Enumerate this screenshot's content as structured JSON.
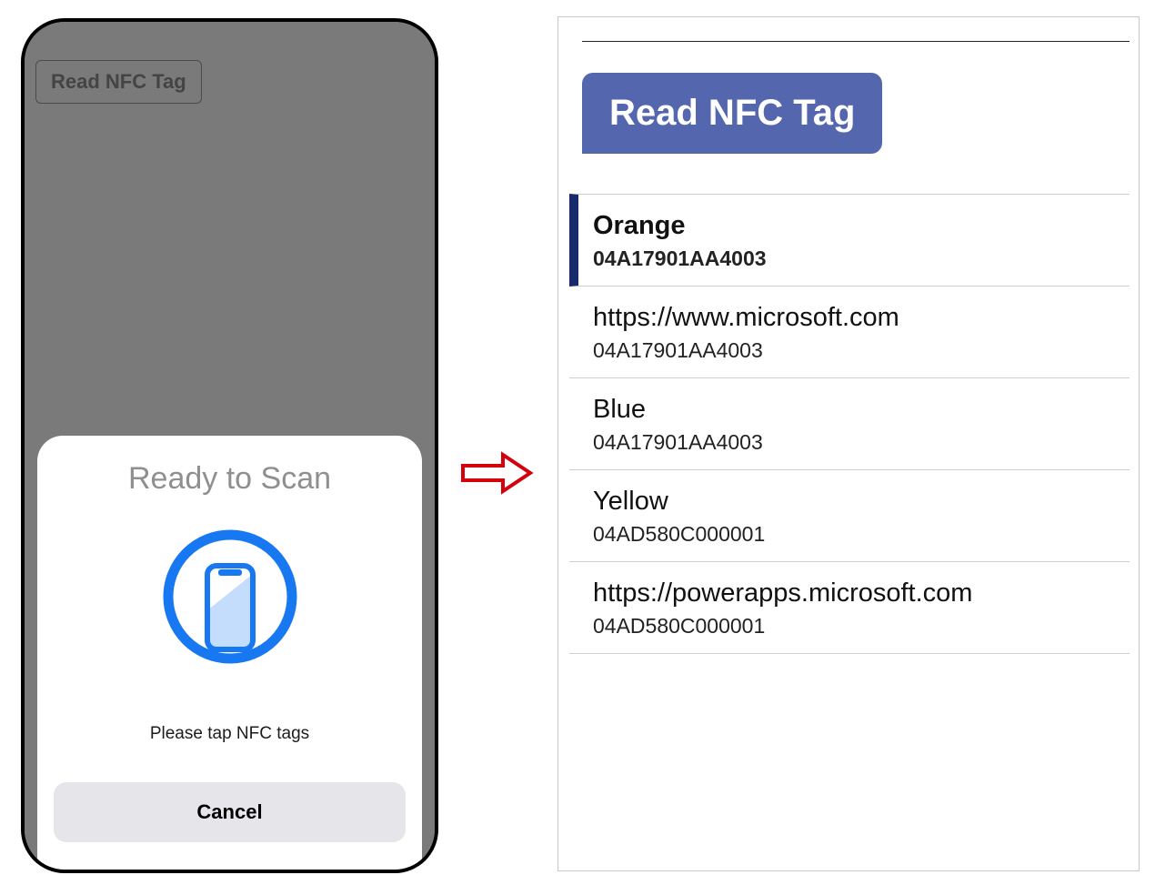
{
  "left": {
    "bg_button_label": "Read NFC Tag",
    "sheet_title": "Ready to Scan",
    "sheet_subtitle": "Please tap NFC tags",
    "cancel_label": "Cancel"
  },
  "right": {
    "read_button_label": "Read NFC Tag",
    "items": [
      {
        "primary": "Orange",
        "secondary": "04A17901AA4003",
        "selected": true
      },
      {
        "primary": "https://www.microsoft.com",
        "secondary": "04A17901AA4003",
        "selected": false
      },
      {
        "primary": "Blue",
        "secondary": "04A17901AA4003",
        "selected": false
      },
      {
        "primary": "Yellow",
        "secondary": "04AD580C000001",
        "selected": false
      },
      {
        "primary": "https://powerapps.microsoft.com",
        "secondary": "04AD580C000001",
        "selected": false
      }
    ]
  }
}
